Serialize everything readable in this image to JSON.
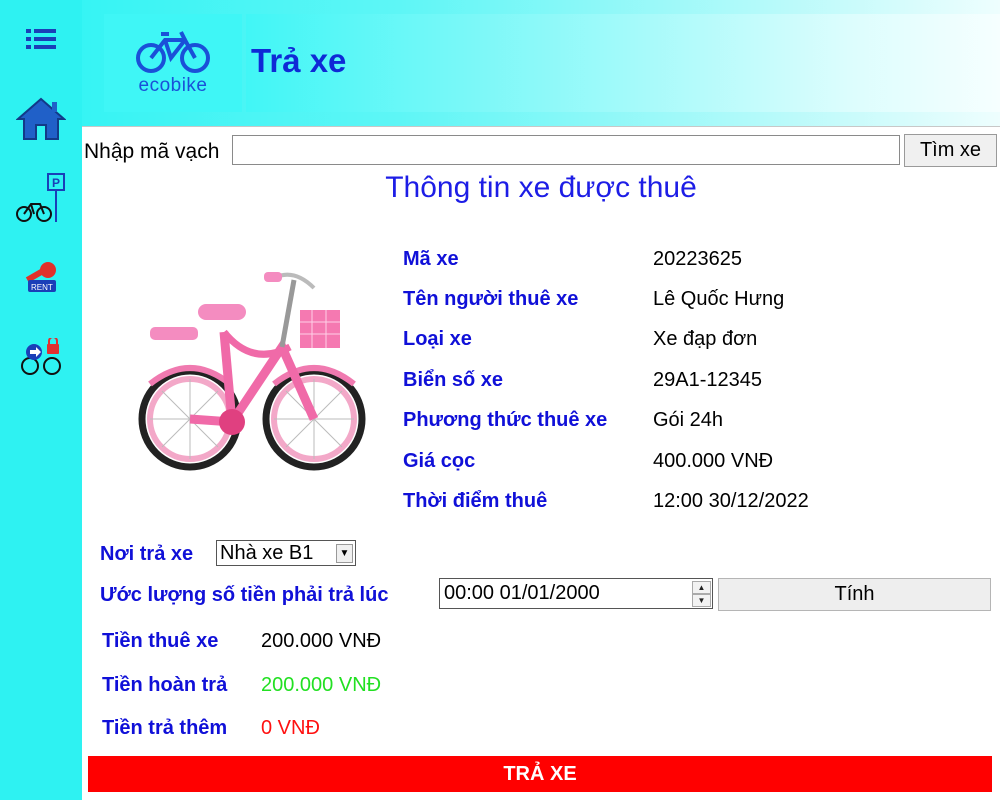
{
  "header": {
    "logo_text": "ecobike",
    "title": "Trả xe"
  },
  "sidebar": {
    "items": [
      {
        "icon": "menu-icon"
      },
      {
        "icon": "home-icon"
      },
      {
        "icon": "bike-parking-icon"
      },
      {
        "icon": "rent-key-icon"
      },
      {
        "icon": "return-bike-icon"
      }
    ]
  },
  "search": {
    "label": "Nhập mã vạch",
    "value": "",
    "button_label": "Tìm xe"
  },
  "section_title": "Thông tin xe được thuê",
  "bike_info": [
    {
      "label": "Mã xe",
      "value": "20223625"
    },
    {
      "label": "Tên người thuê xe",
      "value": "Lê Quốc Hưng"
    },
    {
      "label": "Loại xe",
      "value": "Xe đạp đơn"
    },
    {
      "label": "Biển số xe",
      "value": "29A1-12345"
    },
    {
      "label": "Phương thức thuê xe",
      "value": "Gói 24h"
    },
    {
      "label": "Giá cọc",
      "value": "400.000 VNĐ"
    },
    {
      "label": "Thời điểm thuê",
      "value": "12:00 30/12/2022"
    }
  ],
  "return_form": {
    "dock_label": "Nơi trả xe",
    "dock_selected": "Nhà xe B1",
    "estimate_label": "Ước lượng số tiền phải trả lúc",
    "estimate_time": "00:00 01/01/2000",
    "calc_button": "Tính"
  },
  "fees": [
    {
      "label": "Tiền thuê xe",
      "value": "200.000 VNĐ",
      "color": "#000000"
    },
    {
      "label": "Tiền hoàn trả",
      "value": "200.000 VNĐ",
      "color": "#22e022"
    },
    {
      "label": "Tiền trả thêm",
      "value": "0 VNĐ",
      "color": "#ff1010"
    }
  ],
  "return_button": "TRẢ XE",
  "colors": {
    "accent_blue": "#1010d8",
    "sidebar": "#2ef2f2",
    "return_button": "#ff0000"
  }
}
